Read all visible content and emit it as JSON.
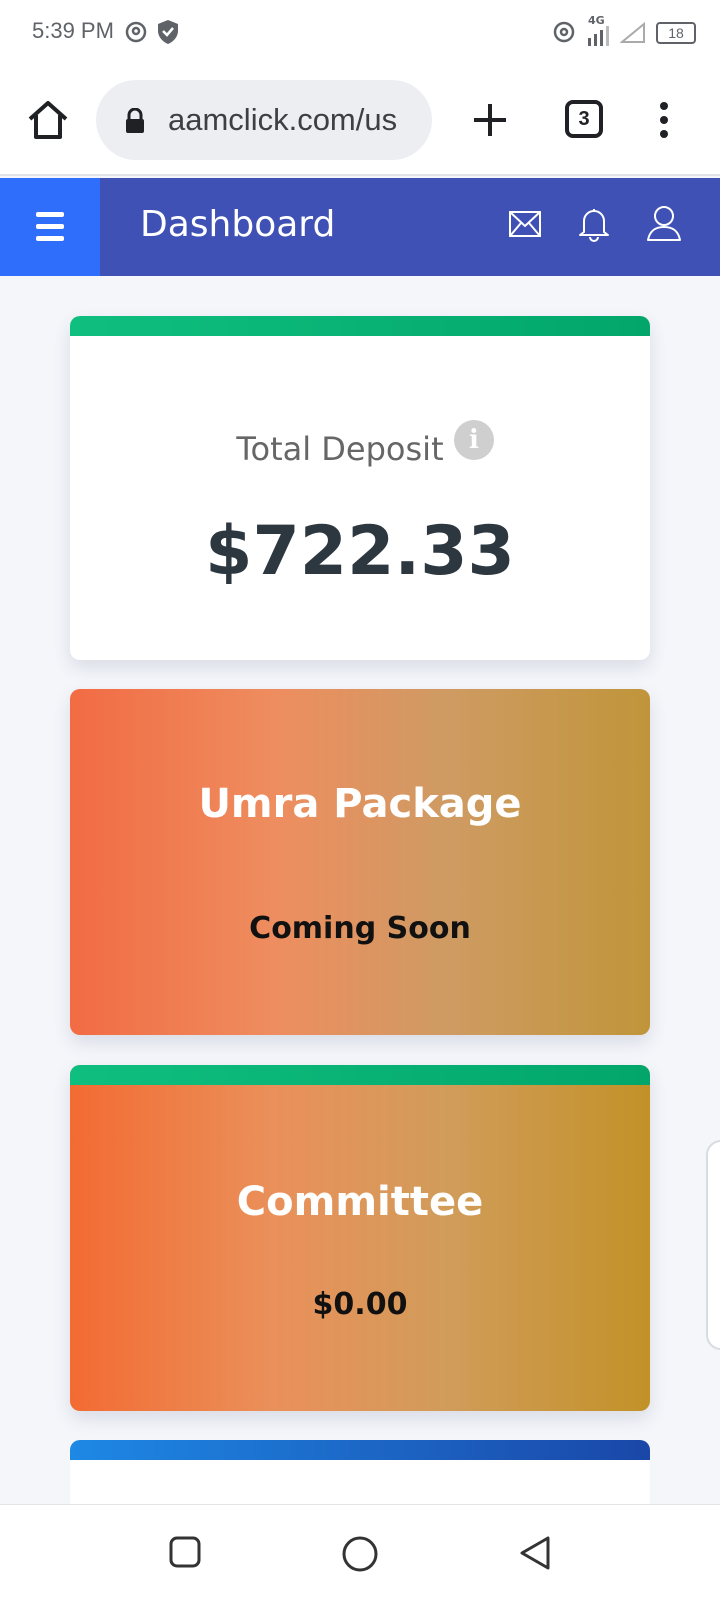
{
  "status_bar": {
    "time": "5:39 PM",
    "network": "4G",
    "battery": "18"
  },
  "browser": {
    "url": "aamclick.com/us",
    "tab_count": "3",
    "icons": [
      "home-icon",
      "lock-icon",
      "new-tab-icon",
      "tabs-icon",
      "more-vert-icon"
    ]
  },
  "header": {
    "title": "Dashboard",
    "icons": [
      "menu-icon",
      "mail-icon",
      "bell-icon",
      "user-icon"
    ],
    "accent": "#3f51b5",
    "menu_bg": "#2f6dfb"
  },
  "cards": {
    "deposit": {
      "label": "Total Deposit",
      "info": "i",
      "value": "$722.33"
    },
    "umra": {
      "title": "Umra Package",
      "subtitle": "Coming Soon"
    },
    "committee": {
      "title": "Committee",
      "value": "$0.00"
    }
  },
  "colors": {
    "green_strip": "#0fbf7f",
    "blue_strip": "#1e88e5",
    "gradient_start": "#f26b43",
    "gradient_end": "#c0953a"
  },
  "nav": {
    "icons": [
      "recent-apps-icon",
      "home-circle-icon",
      "back-icon"
    ]
  }
}
